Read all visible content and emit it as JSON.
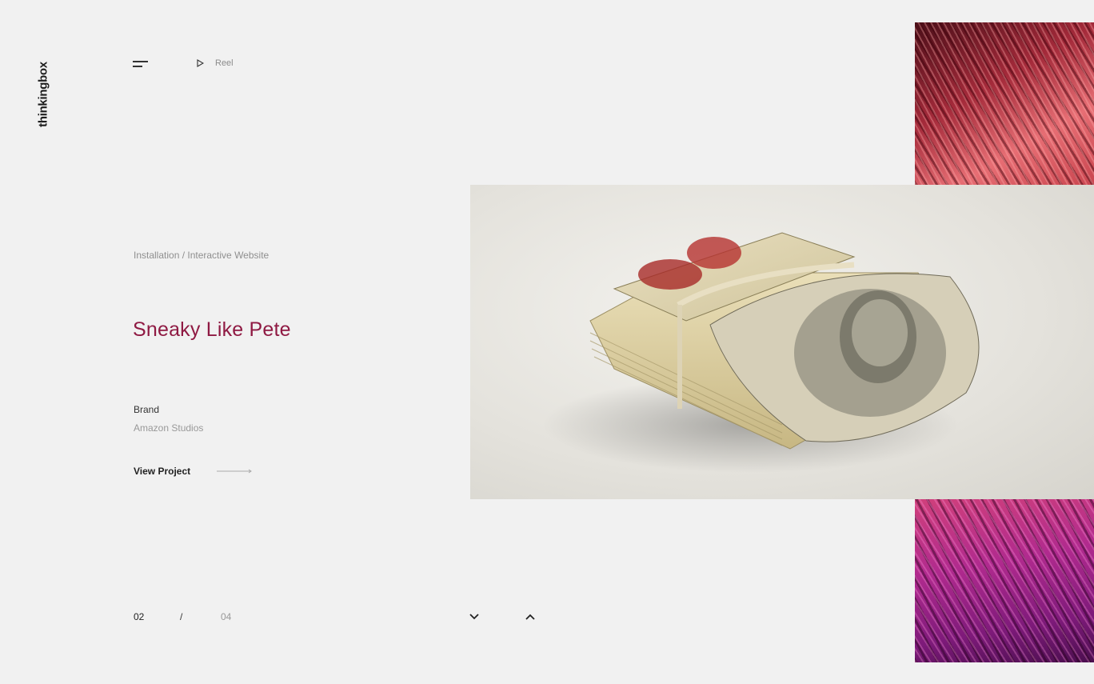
{
  "brand": {
    "logo_text": "thinkingbox"
  },
  "header": {
    "reel_label": "Reel"
  },
  "project": {
    "category": "Installation / Interactive Website",
    "title": "Sneaky Like Pete",
    "brand_label": "Brand",
    "brand_value": "Amazon Studios",
    "view_label": "View Project"
  },
  "pagination": {
    "current": "02",
    "separator": "/",
    "total": "04"
  },
  "colors": {
    "accent": "#8f1a43",
    "background": "#f1f1f1"
  },
  "icons": [
    "menu-icon",
    "play-icon",
    "arrow-right-icon",
    "chevron-down-icon",
    "chevron-up-icon"
  ],
  "images": {
    "hero": "rolled stack of hundred-dollar bills with red fingerprints",
    "thumb_top": "red fiber texture",
    "thumb_bottom": "magenta fiber texture"
  }
}
